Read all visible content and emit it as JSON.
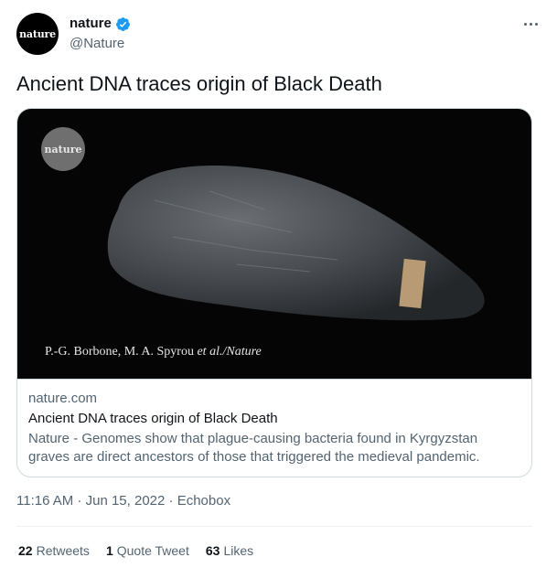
{
  "account": {
    "avatar_text": "nature",
    "display_name": "nature",
    "handle": "@Nature",
    "verified_color": "#1d9bf0"
  },
  "tweet": {
    "text": "Ancient DNA traces origin of Black Death"
  },
  "card": {
    "image_logo_text": "nature",
    "image_credit_prefix": "P.-G. Borbone, M. A. Spyrou ",
    "image_credit_italic": "et al./Nature",
    "domain": "nature.com",
    "title": "Ancient DNA traces origin of Black Death",
    "description": "Nature - Genomes show that plague-causing bacteria found in Kyrgyzstan graves are direct ancestors of those that triggered the medieval pandemic."
  },
  "meta": {
    "time": "11:16 AM",
    "separator": " · ",
    "date": "Jun 15, 2022",
    "source": "Echobox"
  },
  "stats": {
    "retweets_count": "22",
    "retweets_label": "Retweets",
    "quotes_count": "1",
    "quotes_label": "Quote Tweet",
    "likes_count": "63",
    "likes_label": "Likes"
  },
  "icons": {
    "more": "more-horizontal-icon",
    "verified": "verified-badge-icon"
  }
}
